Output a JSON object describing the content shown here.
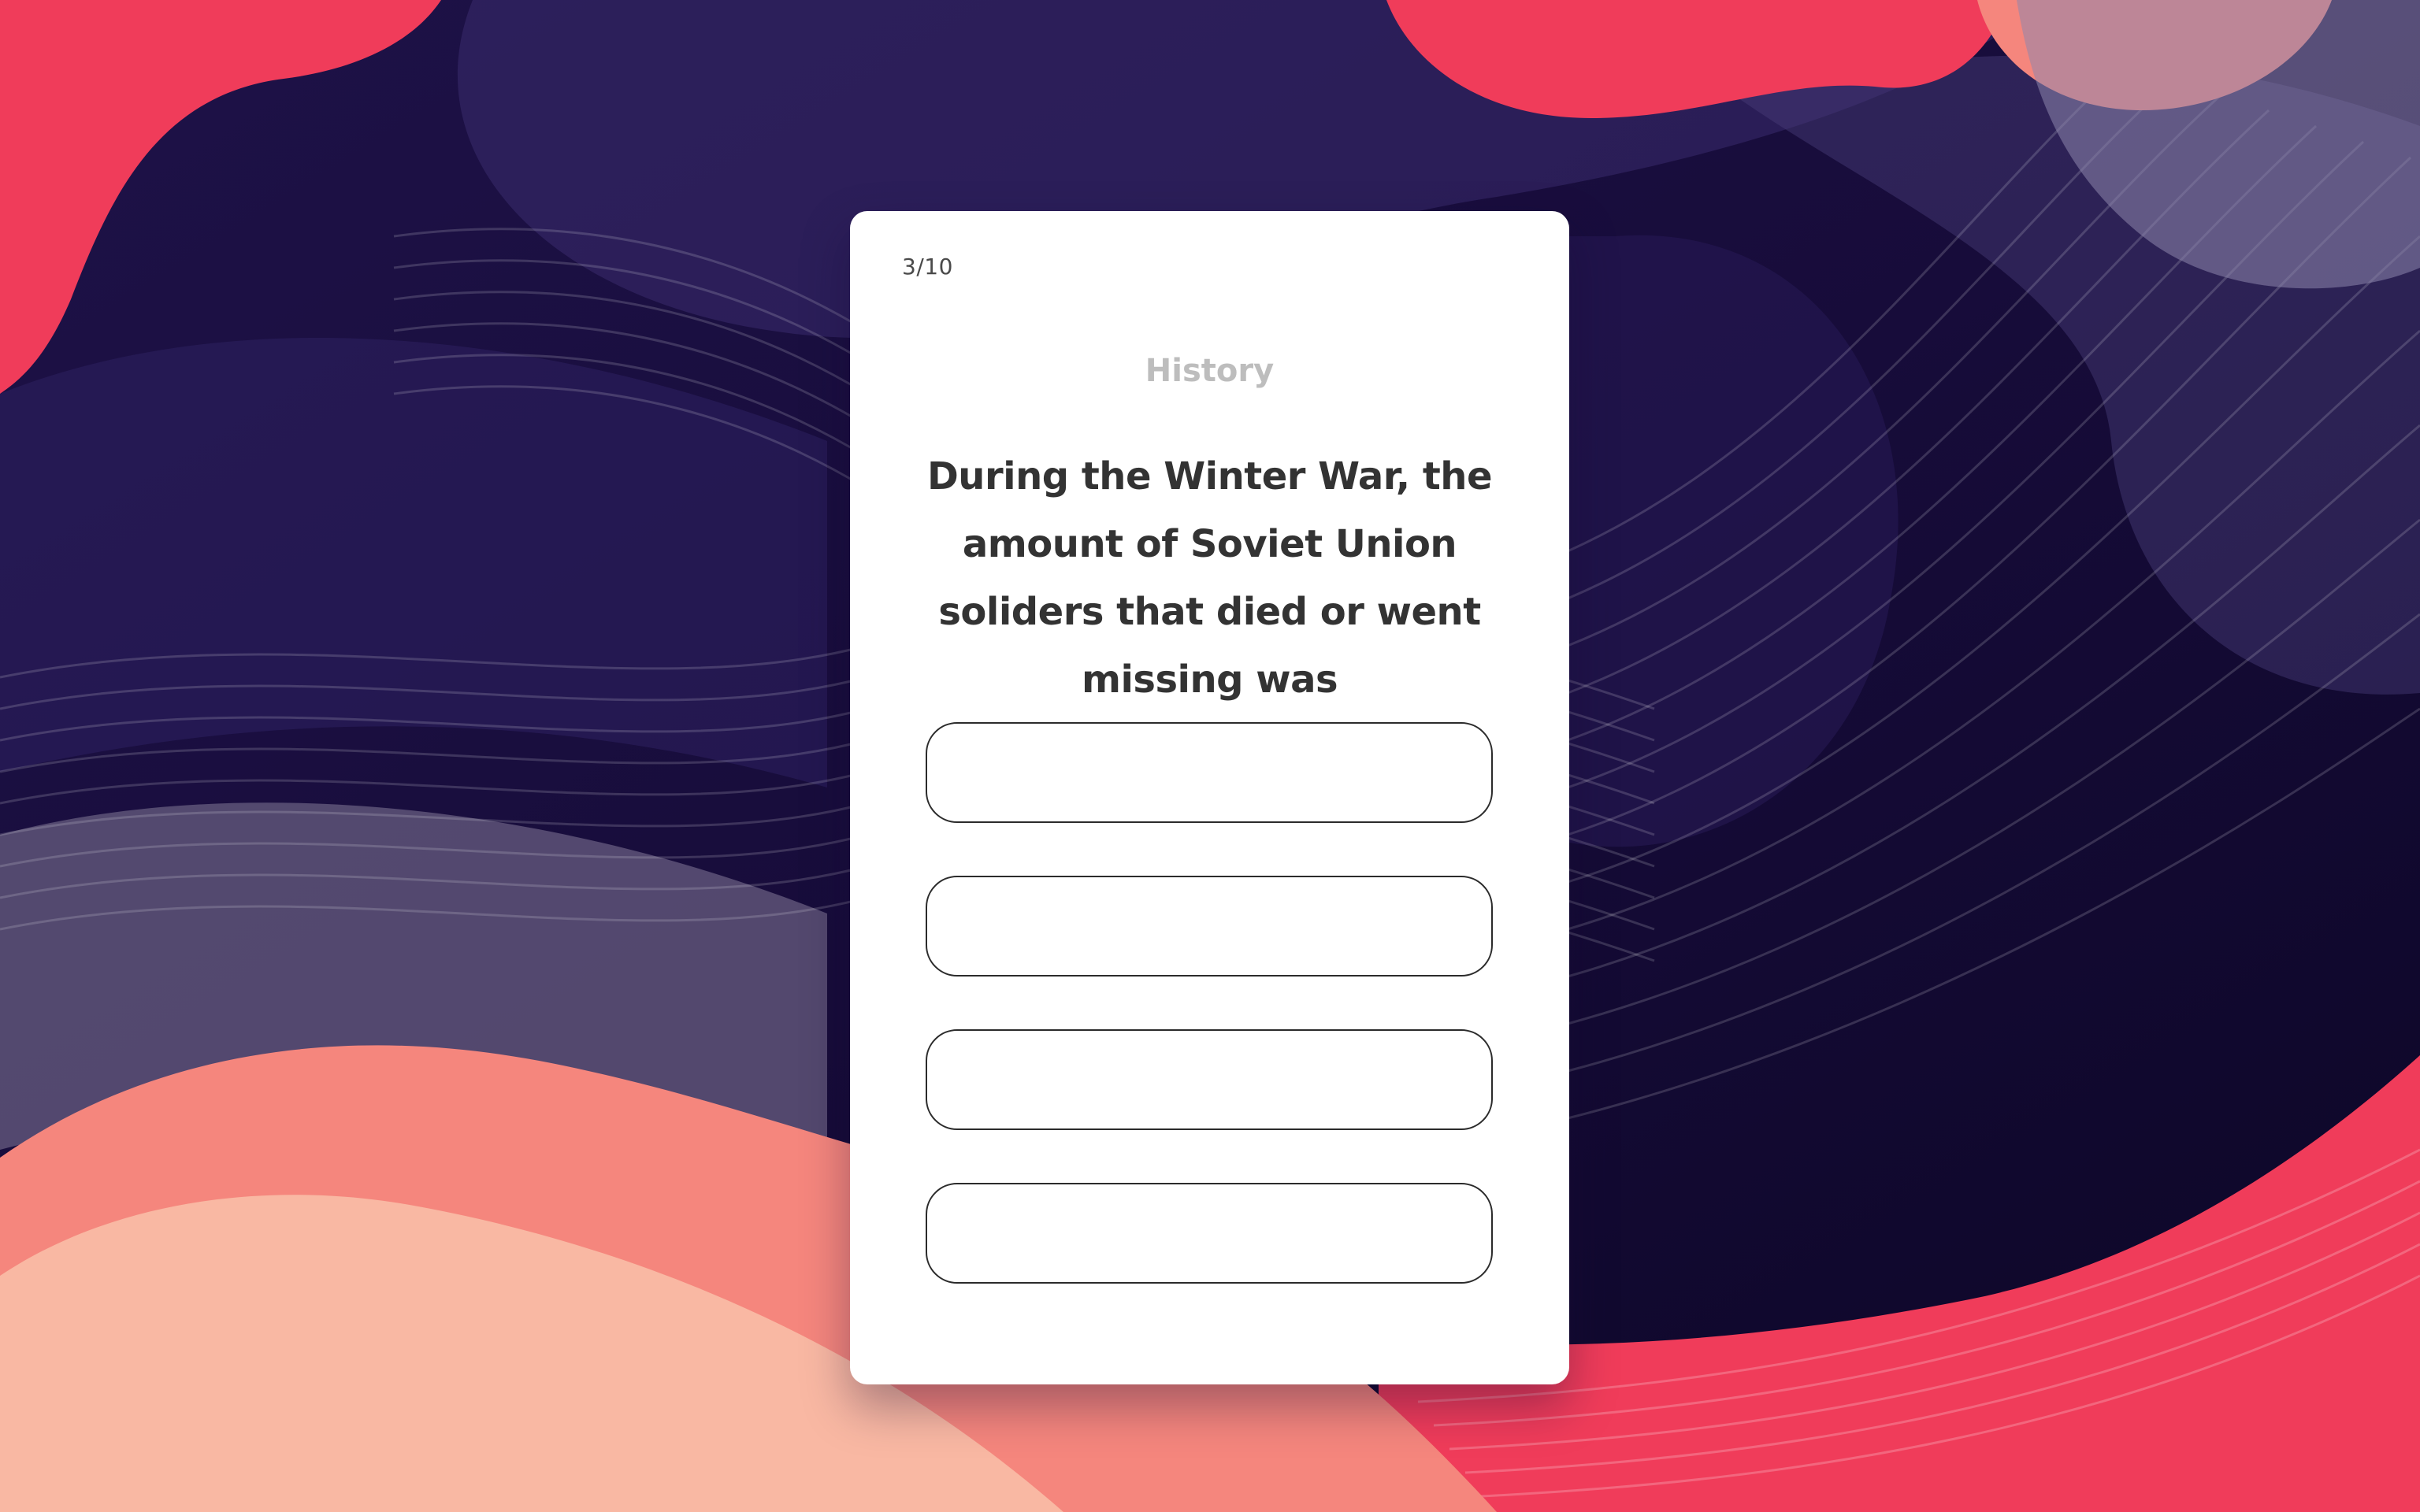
{
  "quiz": {
    "progress": "3/10",
    "category": "History",
    "question": "During the Winter War, the amount of Soviet Union soliders that died or went missing was",
    "answers": [
      "",
      "",
      "",
      ""
    ]
  },
  "colors": {
    "background_dark": "#1a0f3d",
    "accent_red": "#f03c5a",
    "accent_salmon": "#f5867d",
    "accent_peach": "#f9b8a3",
    "card": "#ffffff",
    "question_text": "#333333",
    "category_text": "#bdbdbd"
  }
}
